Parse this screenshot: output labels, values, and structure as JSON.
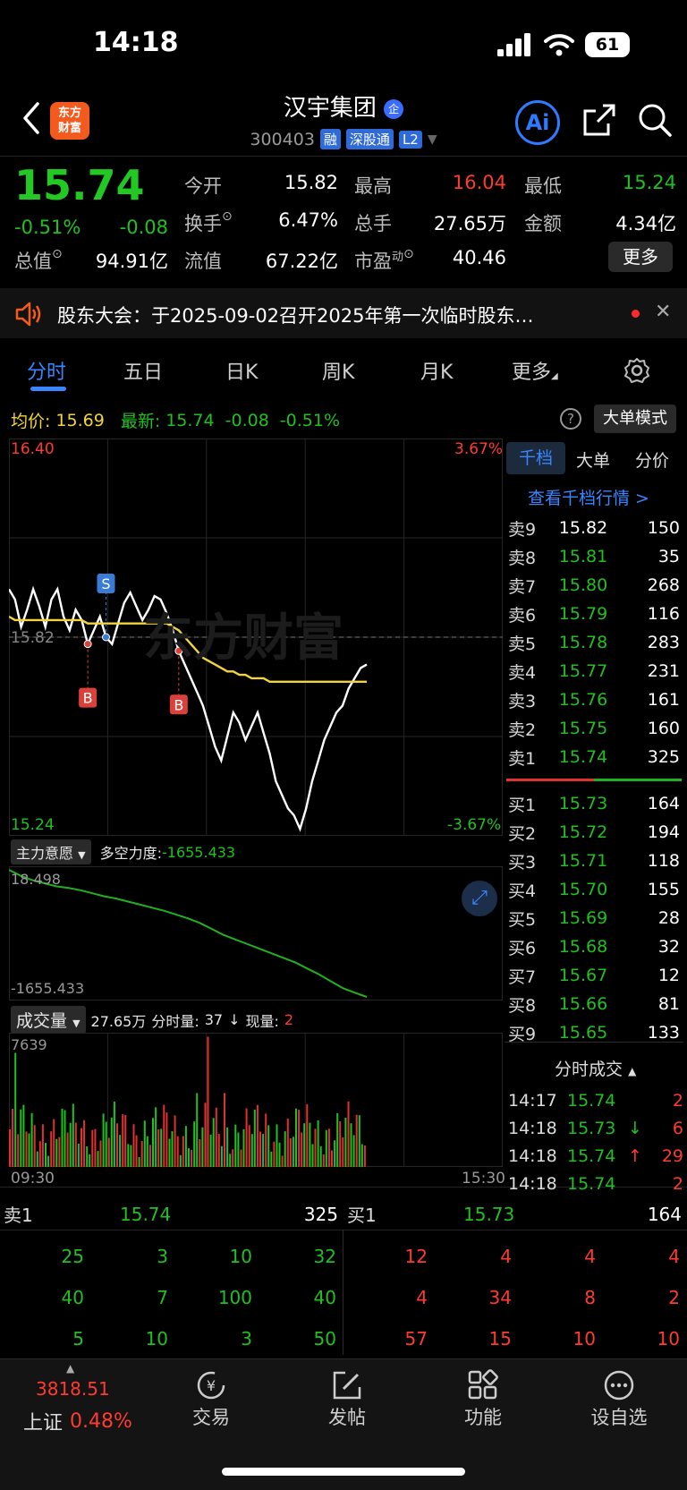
{
  "status": {
    "time": "14:18",
    "battery": "61"
  },
  "header": {
    "app_logo_lines": [
      "东方",
      "财富"
    ],
    "stock_name": "汉宇集团",
    "stock_code": "300403",
    "tags": [
      "融",
      "深股通",
      "L2"
    ],
    "ai_label": "Ai"
  },
  "quote": {
    "price": "15.74",
    "change_pct": "-0.51%",
    "change": "-0.08",
    "fields": {
      "open_label": "今开",
      "open": "15.82",
      "high_label": "最高",
      "high": "16.04",
      "low_label": "最低",
      "low": "15.24",
      "turnover_label": "换手",
      "turnover": "6.47%",
      "volume_label": "总手",
      "volume": "27.65万",
      "amount_label": "金额",
      "amount": "4.34亿",
      "mktcap_label": "总值",
      "mktcap": "94.91亿",
      "float_label": "流值",
      "float": "67.22亿",
      "pe_label": "市盈",
      "pe_sup": "动",
      "pe": "40.46"
    },
    "more_button": "更多"
  },
  "notice": {
    "text": "股东大会：于2025-09-02召开2025年第一次临时股东…"
  },
  "tabs": [
    "分时",
    "五日",
    "日K",
    "周K",
    "月K",
    "更多"
  ],
  "chart_header": {
    "avg_label": "均价:",
    "avg": "15.69",
    "latest_label": "最新:",
    "latest": "15.74",
    "chg": "-0.08",
    "chg_pct": "-0.51%",
    "mode_button": "大单模式"
  },
  "chart_data": [
    {
      "type": "line",
      "title": "分时",
      "y_axis_left": [
        "16.40",
        "15.82",
        "15.24"
      ],
      "y_axis_right": [
        "3.67%",
        "-3.67%"
      ],
      "ylim": [
        15.24,
        16.4
      ],
      "prev_close": 15.82,
      "series": [
        {
          "name": "价格",
          "color": "#ffffff",
          "values": [
            15.96,
            15.93,
            15.85,
            15.9,
            15.96,
            15.91,
            15.85,
            15.93,
            15.96,
            15.88,
            15.84,
            15.9,
            15.87,
            15.8,
            15.84,
            15.88,
            15.82,
            15.8,
            15.86,
            15.92,
            15.95,
            15.91,
            15.87,
            15.9,
            15.94,
            15.93,
            15.89,
            15.84,
            15.78,
            15.74,
            15.7,
            15.66,
            15.62,
            15.56,
            15.5,
            15.46,
            15.53,
            15.6,
            15.57,
            15.52,
            15.56,
            15.6,
            15.54,
            15.48,
            15.4,
            15.36,
            15.32,
            15.3,
            15.26,
            15.32,
            15.4,
            15.46,
            15.52,
            15.56,
            15.6,
            15.62,
            15.67,
            15.7,
            15.73,
            15.74
          ]
        },
        {
          "name": "均价",
          "color": "#f3d43a",
          "values": [
            15.88,
            15.87,
            15.87,
            15.87,
            15.87,
            15.87,
            15.87,
            15.87,
            15.87,
            15.87,
            15.87,
            15.87,
            15.87,
            15.86,
            15.86,
            15.86,
            15.86,
            15.86,
            15.86,
            15.86,
            15.86,
            15.86,
            15.86,
            15.86,
            15.86,
            15.86,
            15.86,
            15.85,
            15.84,
            15.82,
            15.8,
            15.78,
            15.76,
            15.75,
            15.74,
            15.73,
            15.72,
            15.72,
            15.71,
            15.71,
            15.7,
            15.7,
            15.7,
            15.69,
            15.69,
            15.69,
            15.69,
            15.69,
            15.69,
            15.69,
            15.69,
            15.69,
            15.69,
            15.69,
            15.69,
            15.69,
            15.69,
            15.69,
            15.69,
            15.69
          ]
        }
      ],
      "markers": [
        {
          "label": "S"
        },
        {
          "label": "B"
        },
        {
          "label": "B"
        }
      ],
      "watermark": "东方财富"
    },
    {
      "type": "line",
      "title": "主力意愿",
      "indicator_label": "多空力度:",
      "indicator_value": "-1655.433",
      "y_axis": [
        "18.498",
        "-1655.433"
      ],
      "series": [
        {
          "name": "多空力度",
          "color": "#1fb11f",
          "values": [
            18.5,
            -60,
            -120,
            -160,
            -200,
            -220,
            -250,
            -290,
            -330,
            -360,
            -400,
            -440,
            -480,
            -520,
            -570,
            -620,
            -680,
            -760,
            -840,
            -900,
            -960,
            -1020,
            -1080,
            -1140,
            -1200,
            -1280,
            -1360,
            -1450,
            -1540,
            -1600,
            -1655.433
          ]
        }
      ]
    },
    {
      "type": "bar",
      "title": "成交量",
      "summary": "27.65万",
      "period_label": "分时量:",
      "period_value": "37",
      "now_label": "现量:",
      "now_value": "2",
      "y_max_label": "7639",
      "x_axis": [
        "09:30",
        "15:30"
      ]
    }
  ],
  "orderbook": {
    "tabs": [
      "千档",
      "大单",
      "分价"
    ],
    "link": "查看千档行情 >",
    "asks": [
      {
        "label": "卖9",
        "price": "15.82",
        "qty": "150"
      },
      {
        "label": "卖8",
        "price": "15.81",
        "qty": "35"
      },
      {
        "label": "卖7",
        "price": "15.80",
        "qty": "268"
      },
      {
        "label": "卖6",
        "price": "15.79",
        "qty": "116"
      },
      {
        "label": "卖5",
        "price": "15.78",
        "qty": "283"
      },
      {
        "label": "卖4",
        "price": "15.77",
        "qty": "231"
      },
      {
        "label": "卖3",
        "price": "15.76",
        "qty": "161"
      },
      {
        "label": "卖2",
        "price": "15.75",
        "qty": "160"
      },
      {
        "label": "卖1",
        "price": "15.74",
        "qty": "325"
      }
    ],
    "bids": [
      {
        "label": "买1",
        "price": "15.73",
        "qty": "164"
      },
      {
        "label": "买2",
        "price": "15.72",
        "qty": "194"
      },
      {
        "label": "买3",
        "price": "15.71",
        "qty": "118"
      },
      {
        "label": "买4",
        "price": "15.70",
        "qty": "155"
      },
      {
        "label": "买5",
        "price": "15.69",
        "qty": "28"
      },
      {
        "label": "买6",
        "price": "15.68",
        "qty": "32"
      },
      {
        "label": "买7",
        "price": "15.67",
        "qty": "12"
      },
      {
        "label": "买8",
        "price": "15.66",
        "qty": "81"
      },
      {
        "label": "买9",
        "price": "15.65",
        "qty": "133"
      }
    ],
    "trades_title": "分时成交",
    "trades": [
      {
        "time": "14:17",
        "price": "15.74",
        "arrow": "",
        "qty": "2"
      },
      {
        "time": "14:18",
        "price": "15.73",
        "arrow": "↓",
        "qty": "6"
      },
      {
        "time": "14:18",
        "price": "15.74",
        "arrow": "↑",
        "qty": "29"
      },
      {
        "time": "14:18",
        "price": "15.74",
        "arrow": "",
        "qty": "2"
      }
    ]
  },
  "queue": {
    "ask_label": "卖1",
    "ask_price": "15.74",
    "ask_qty": "325",
    "bid_label": "买1",
    "bid_price": "15.73",
    "bid_qty": "164",
    "ask_rows": [
      [
        "25",
        "3",
        "10",
        "32"
      ],
      [
        "40",
        "7",
        "100",
        "40"
      ],
      [
        "5",
        "10",
        "3",
        "50"
      ]
    ],
    "bid_rows": [
      [
        "12",
        "4",
        "4",
        "4"
      ],
      [
        "4",
        "34",
        "8",
        "2"
      ],
      [
        "57",
        "15",
        "10",
        "10"
      ]
    ]
  },
  "bottom_nav": {
    "index_value": "3818.51",
    "index_name": "上证",
    "index_pct": "0.48%",
    "items": [
      {
        "label": "交易",
        "icon": "trade-yen-icon"
      },
      {
        "label": "发帖",
        "icon": "compose-icon"
      },
      {
        "label": "功能",
        "icon": "grid-icon"
      },
      {
        "label": "设自选",
        "icon": "more-dots-icon"
      }
    ]
  }
}
